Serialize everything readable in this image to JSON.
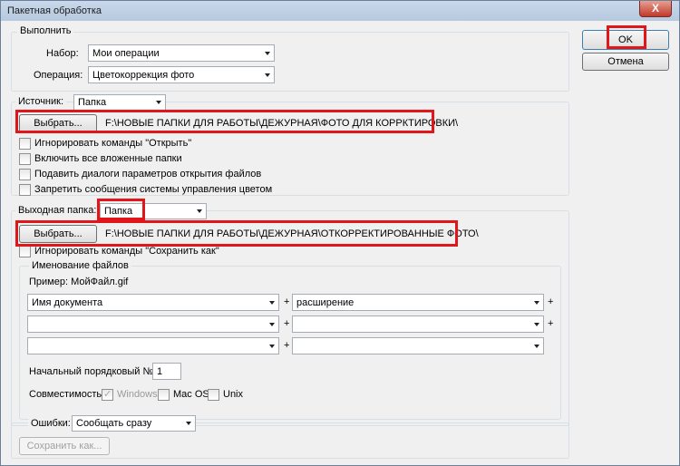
{
  "window": {
    "title": "Пакетная обработка",
    "close_glyph": "X"
  },
  "buttons": {
    "ok": "OK",
    "cancel": "Отмена"
  },
  "run": {
    "legend": "Выполнить",
    "set_label": "Набор:",
    "set_value": "Мои операции",
    "action_label": "Операция:",
    "action_value": "Цветокоррекция фото"
  },
  "source": {
    "label": "Источник:",
    "value": "Папка",
    "choose": "Выбрать...",
    "path": "F:\\НОВЫЕ ПАПКИ ДЛЯ РАБОТЫ\\ДЕЖУРНАЯ\\ФОТО ДЛЯ КОРРКТИРОВКИ\\",
    "options": [
      "Игнорировать команды \"Открыть\"",
      "Включить все вложенные папки",
      "Подавить диалоги параметров открытия файлов",
      "Запретить сообщения системы управления цветом"
    ]
  },
  "destination": {
    "label": "Выходная папка:",
    "value": "Папка",
    "choose": "Выбрать...",
    "path": "F:\\НОВЫЕ ПАПКИ ДЛЯ РАБОТЫ\\ДЕЖУРНАЯ\\ОТКОРРЕКТИРОВАННЫЕ ФОТО\\",
    "ignore_save": "Игнорировать команды \"Сохранить как\""
  },
  "naming": {
    "legend": "Именование файлов",
    "example": "Пример: МойФайл.gif",
    "rows": [
      [
        "Имя документа",
        "расширение"
      ],
      [
        "",
        ""
      ],
      [
        "",
        ""
      ]
    ],
    "plus": "+",
    "start_label": "Начальный порядковый №:",
    "start_value": "1",
    "compat_label": "Совместимость:",
    "compat": [
      "Windows",
      "Mac OS",
      "Unix"
    ]
  },
  "errors": {
    "label": "Ошибки:",
    "value": "Сообщать сразу",
    "save_as": "Сохранить как..."
  },
  "colors": {
    "highlight": "#e0161b"
  }
}
